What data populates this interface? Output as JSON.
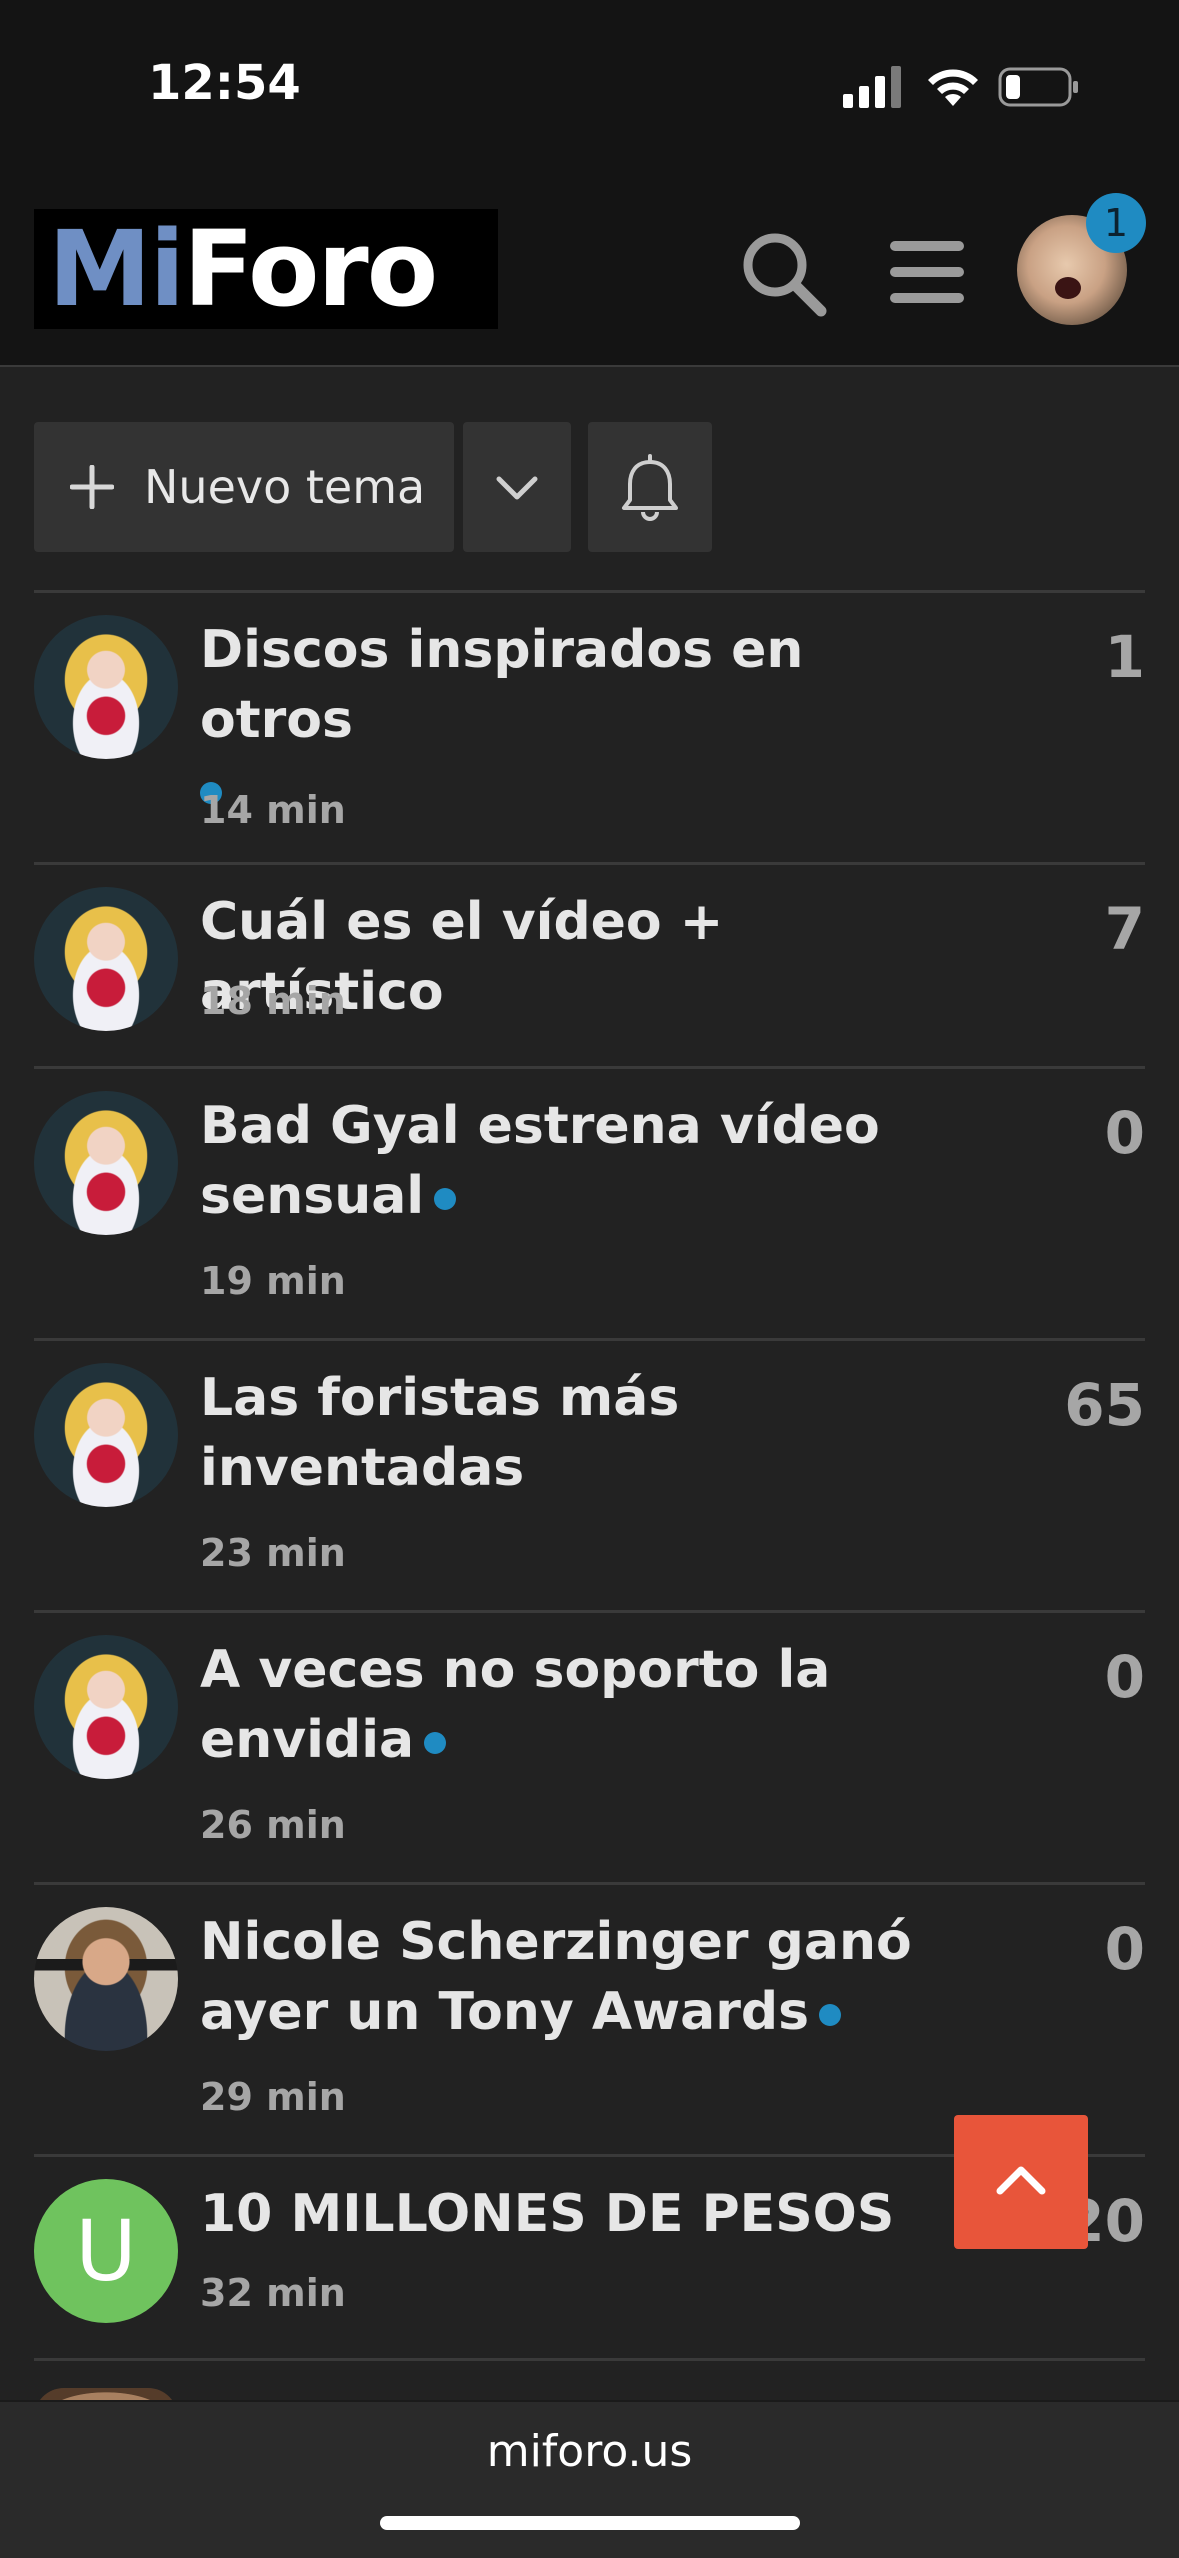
{
  "status_bar": {
    "time": "12:54"
  },
  "header": {
    "logo_part1": "Mi",
    "logo_part2": "Foro",
    "notification_count": "1"
  },
  "toolbar": {
    "new_topic_label": "Nuevo tema"
  },
  "topics": [
    {
      "title": "Discos inspirados en otros",
      "unread": true,
      "time": "14 min",
      "replies": "1",
      "avatar": "sailor"
    },
    {
      "title": "Cuál es el vídeo + artístico",
      "unread": false,
      "time": "18 min",
      "replies": "7",
      "avatar": "sailor"
    },
    {
      "title": "Bad Gyal estrena vídeo sensual",
      "unread": true,
      "time": "19 min",
      "replies": "0",
      "avatar": "sailor"
    },
    {
      "title": "Las foristas más inventadas",
      "unread": false,
      "time": "23 min",
      "replies": "65",
      "avatar": "sailor"
    },
    {
      "title": "A veces no soporto la envidia",
      "unread": true,
      "time": "26 min",
      "replies": "0",
      "avatar": "sailor"
    },
    {
      "title": "Nicole Scherzinger ganó ayer un Tony Awards",
      "unread": true,
      "time": "29 min",
      "replies": "0",
      "avatar": "nicole"
    },
    {
      "title": "10 MILLONES DE PESOS",
      "unread": false,
      "time": "32 min",
      "replies": "20",
      "avatar": "letter",
      "avatar_letter": "U"
    }
  ],
  "browser": {
    "url": "miforo.us"
  },
  "colors": {
    "accent_blue": "#1f8bc2",
    "scroll_button": "#e8553a",
    "avatar_green": "#6fc35e"
  }
}
